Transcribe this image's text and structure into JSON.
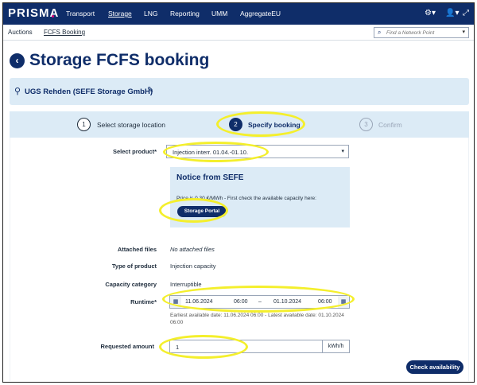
{
  "topnav": {
    "logo": "PRISMA",
    "items": [
      "Transport",
      "Storage",
      "LNG",
      "Reporting",
      "UMM",
      "AggregateEU"
    ],
    "active_item": "Storage",
    "icons": [
      "gear-icon",
      "user-icon",
      "expand-icon"
    ]
  },
  "subnav": {
    "links": [
      "Auctions",
      "FCFS Booking"
    ],
    "active_link": "FCFS Booking",
    "search_placeholder": "Find a Network Point"
  },
  "page": {
    "title": "Storage FCFS booking",
    "location": "UGS Rehden (SEFE Storage GmbH)"
  },
  "stepper": {
    "steps": [
      {
        "number": "1",
        "label": "Select storage location",
        "state": "done"
      },
      {
        "number": "2",
        "label": "Specify booking",
        "state": "active"
      },
      {
        "number": "3",
        "label": "Confirm",
        "state": "future"
      }
    ]
  },
  "form": {
    "product_label": "Select product*",
    "product_value": "Injection interr. 01.04.-01.10.",
    "notice_title": "Notice from SEFE",
    "notice_text": "Price is 0.30 €/MWh - First check the available capacity here:",
    "portal_button": "Storage Portal",
    "attached_files_label": "Attached files",
    "attached_files_value": "No attached files",
    "product_type_label": "Type of product",
    "product_type_value": "Injection capacity",
    "capacity_category_label": "Capacity category",
    "capacity_category_value": "Interruptible",
    "runtime_label": "Runtime*",
    "runtime_start_date": "11.06.2024",
    "runtime_start_time": "06:00",
    "runtime_separator": "–",
    "runtime_end_date": "01.10.2024",
    "runtime_end_time": "06:00",
    "runtime_hint": "Earliest available date: 11.06.2024 06:00 - Latest available date: 01.10.2024 06:00",
    "amount_label": "Requested amount",
    "amount_value": "1",
    "amount_unit": "kWh/h",
    "check_button": "Check availability"
  },
  "colors": {
    "brand_navy": "#0f2d69",
    "panel_light_blue": "#dcebf6",
    "highlight_yellow": "#f4ef2c"
  }
}
